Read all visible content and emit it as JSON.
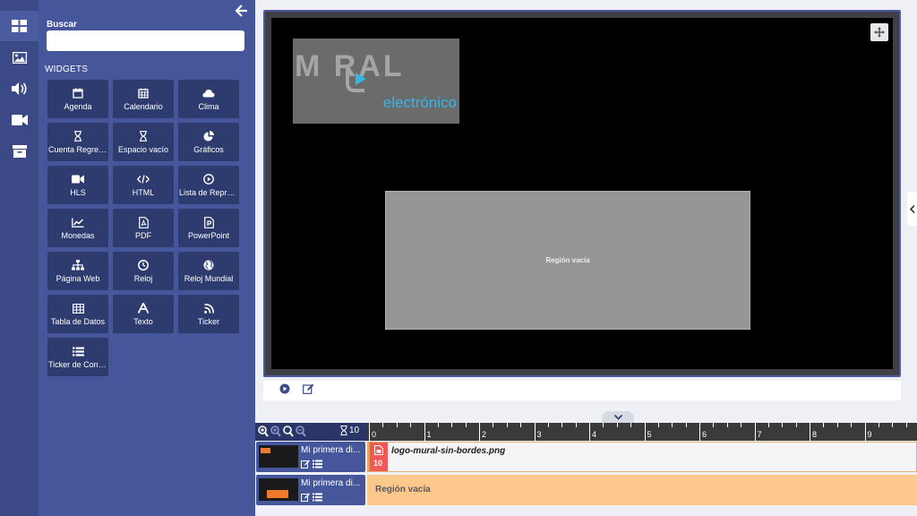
{
  "rail": {
    "items": [
      {
        "icon": "layout-icon",
        "active": true
      },
      {
        "icon": "image-icon",
        "active": false
      },
      {
        "icon": "volume-icon",
        "active": false
      },
      {
        "icon": "video-icon",
        "active": false
      },
      {
        "icon": "archive-icon",
        "active": false
      }
    ]
  },
  "panel": {
    "search_label": "Buscar",
    "search_value": "",
    "section_label": "WIDGETS",
    "widgets": [
      {
        "label": "Agenda",
        "icon": "calendar-icon"
      },
      {
        "label": "Calendario",
        "icon": "calendar-grid-icon"
      },
      {
        "label": "Clima",
        "icon": "cloud-icon"
      },
      {
        "label": "Cuenta Regresiva",
        "icon": "hourglass-icon"
      },
      {
        "label": "Espacio vacío",
        "icon": "hourglass-icon"
      },
      {
        "label": "Gráficos",
        "icon": "pie-chart-icon"
      },
      {
        "label": "HLS",
        "icon": "video-icon"
      },
      {
        "label": "HTML",
        "icon": "code-icon"
      },
      {
        "label": "Lista de Reproducción",
        "icon": "play-circle-icon"
      },
      {
        "label": "Monedas",
        "icon": "line-chart-icon"
      },
      {
        "label": "PDF",
        "icon": "pdf-file-icon"
      },
      {
        "label": "PowerPoint",
        "icon": "powerpoint-file-icon"
      },
      {
        "label": "Página Web",
        "icon": "sitemap-icon"
      },
      {
        "label": "Reloj",
        "icon": "clock-icon"
      },
      {
        "label": "Reloj Mundial",
        "icon": "globe-icon"
      },
      {
        "label": "Tabla de Datos",
        "icon": "table-icon"
      },
      {
        "label": "Texto",
        "icon": "font-icon"
      },
      {
        "label": "Ticker",
        "icon": "rss-icon"
      },
      {
        "label": "Ticker de Contenido",
        "icon": "list-icon"
      }
    ]
  },
  "stage": {
    "logo_main": "M  RAL",
    "logo_sub": "electrónico",
    "empty_region_label": "Región vacía"
  },
  "timeline": {
    "duration": "10",
    "ruler": [
      "0",
      "1",
      "2",
      "3",
      "4",
      "5",
      "6",
      "7",
      "8",
      "9"
    ],
    "tracks": [
      {
        "name": "Mi primera di...",
        "item_name": "logo-mural-sin-bordes.png",
        "item_duration": "10",
        "item_type": "media"
      },
      {
        "name": "Mi primera di...",
        "item_name": "Región vacía",
        "item_type": "empty"
      }
    ]
  },
  "colors": {
    "rail": "#3b4a87",
    "panel": "#46569b",
    "widget": "#2d3b6e",
    "accent_orange": "#fcc88c",
    "media_badge": "#f05757"
  }
}
